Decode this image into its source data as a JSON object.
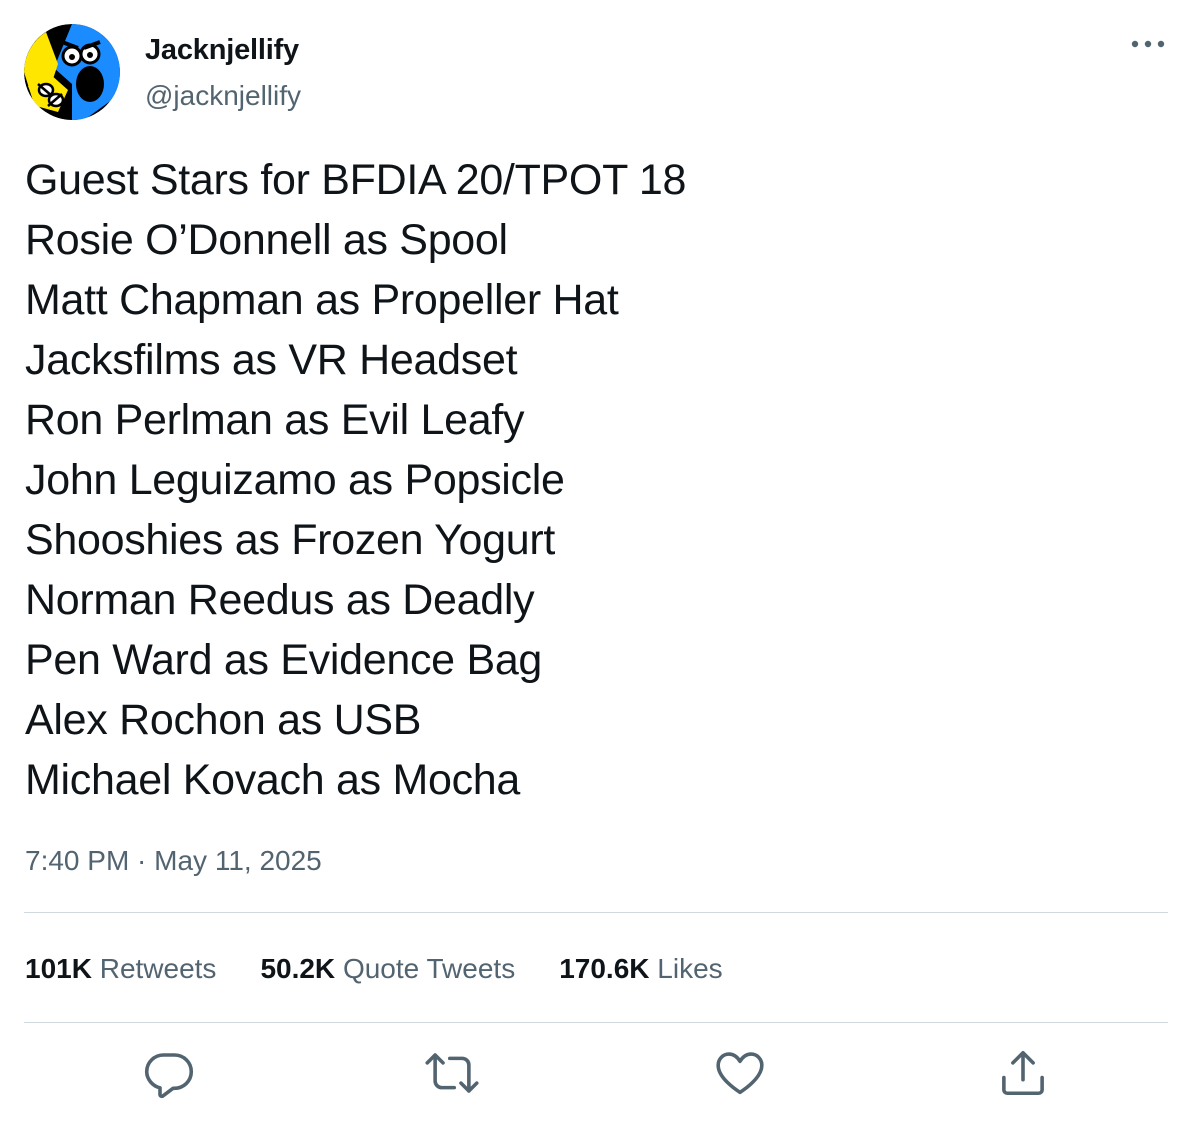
{
  "tweet": {
    "author": {
      "display_name": "Jacknjellify",
      "handle": "@jacknjellify",
      "avatar_icon": "bfdi-character-avatar-icon"
    },
    "more_icon": "more-options-icon",
    "lines": [
      "Guest Stars for BFDIA 20/TPOT 18",
      "Rosie O’Donnell as Spool",
      "Matt Chapman as Propeller Hat",
      "Jacksfilms as VR Headset",
      "Ron Perlman as Evil Leafy",
      "John Leguizamo as Popsicle",
      "Shooshies as Frozen Yogurt",
      "Norman Reedus as Deadly",
      "Pen Ward as Evidence Bag",
      "Alex Rochon as USB",
      "Michael Kovach as Mocha"
    ],
    "timestamp": "7:40 PM · May 11, 2025",
    "stats": {
      "retweets": {
        "count": "101K",
        "label": "Retweets"
      },
      "quotes": {
        "count": "50.2K",
        "label": "Quote Tweets"
      },
      "likes": {
        "count": "170.6K",
        "label": "Likes"
      }
    },
    "actions": [
      "reply-icon",
      "retweet-icon",
      "like-icon",
      "share-icon"
    ]
  },
  "colors": {
    "text_primary": "#0f1419",
    "text_secondary": "#536471",
    "divider": "#cfd9de",
    "avatar_blue": "#1a8cff",
    "avatar_yellow": "#ffe600",
    "avatar_black": "#000000"
  }
}
